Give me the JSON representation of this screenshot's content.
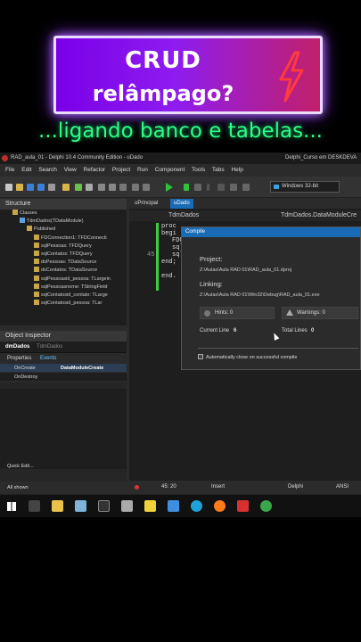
{
  "banner": {
    "title_line1": "CRUD",
    "title_line2": "relâmpago?"
  },
  "subtitle": "...ligando banco e tabelas...",
  "ide": {
    "window_title": "RAD_aula_01 - Delphi 10.4 Community Edition - uDado",
    "window_title_right": "Delphi_Curso em DESKDEVA",
    "menu": [
      "File",
      "Edit",
      "Search",
      "View",
      "Refactor",
      "Project",
      "Run",
      "Component",
      "Tools",
      "Tabs",
      "Help"
    ],
    "platform": "Windows 32-bit",
    "structure": {
      "title": "Structure",
      "items": [
        "Classes",
        "TdmDados(TDataModule)",
        "Published",
        "FDConnection1: TFDConnecti",
        "sqlPessoas: TFDQuery",
        "sqlContatos: TFDQuery",
        "dsPessoas: TDataSource",
        "dsContatos: TDataSource",
        "sqlPessoasid_pessoa: TLargein",
        "sqlPessoasnome: TStringField",
        "sqlContatosid_contato: TLarge",
        "sqlContatosid_pessoa: TLar"
      ]
    },
    "object_inspector": {
      "title": "Object Inspector",
      "selected": "dmDados",
      "selected_type": "TdmDados",
      "tabs": [
        "Properties",
        "Events"
      ],
      "rows": [
        {
          "key": "OnCreate",
          "value": "DataModuleCreate"
        },
        {
          "key": "OnDestroy",
          "value": ""
        }
      ],
      "quick_edit": "Quick Edit...",
      "footer": "All shown"
    },
    "editor": {
      "tabs": [
        "uPrincipal",
        "uDado"
      ],
      "header_left": "TdmDados",
      "header_right": "TdmDados.DataModuleCre",
      "code": [
        "proc",
        "begi",
        "FDC",
        "sql",
        "sql",
        "end;",
        "",
        "end."
      ],
      "line_number": "45",
      "status": {
        "position": "45: 20",
        "mode": "Insert",
        "platform": "Delphi",
        "encoding": "ANSI"
      }
    },
    "compile_dialog": {
      "title": "Compile",
      "project_label": "Project:",
      "project_path": "Z:\\Aulas\\Aula RAD 01\\RAD_aula_01.dproj",
      "linking_label": "Linking:",
      "linking_path": "Z:\\Aulas\\Aula RAD 01\\Win32\\Debug\\RAD_aula_01.exe",
      "hints": "Hints: 0",
      "warnings": "Warnings: 0",
      "current_line_label": "Current Line",
      "current_line_value": "6",
      "total_lines_label": "Total Lines",
      "total_lines_value": "0",
      "auto_close_label": "Automatically close on successful compile"
    }
  }
}
